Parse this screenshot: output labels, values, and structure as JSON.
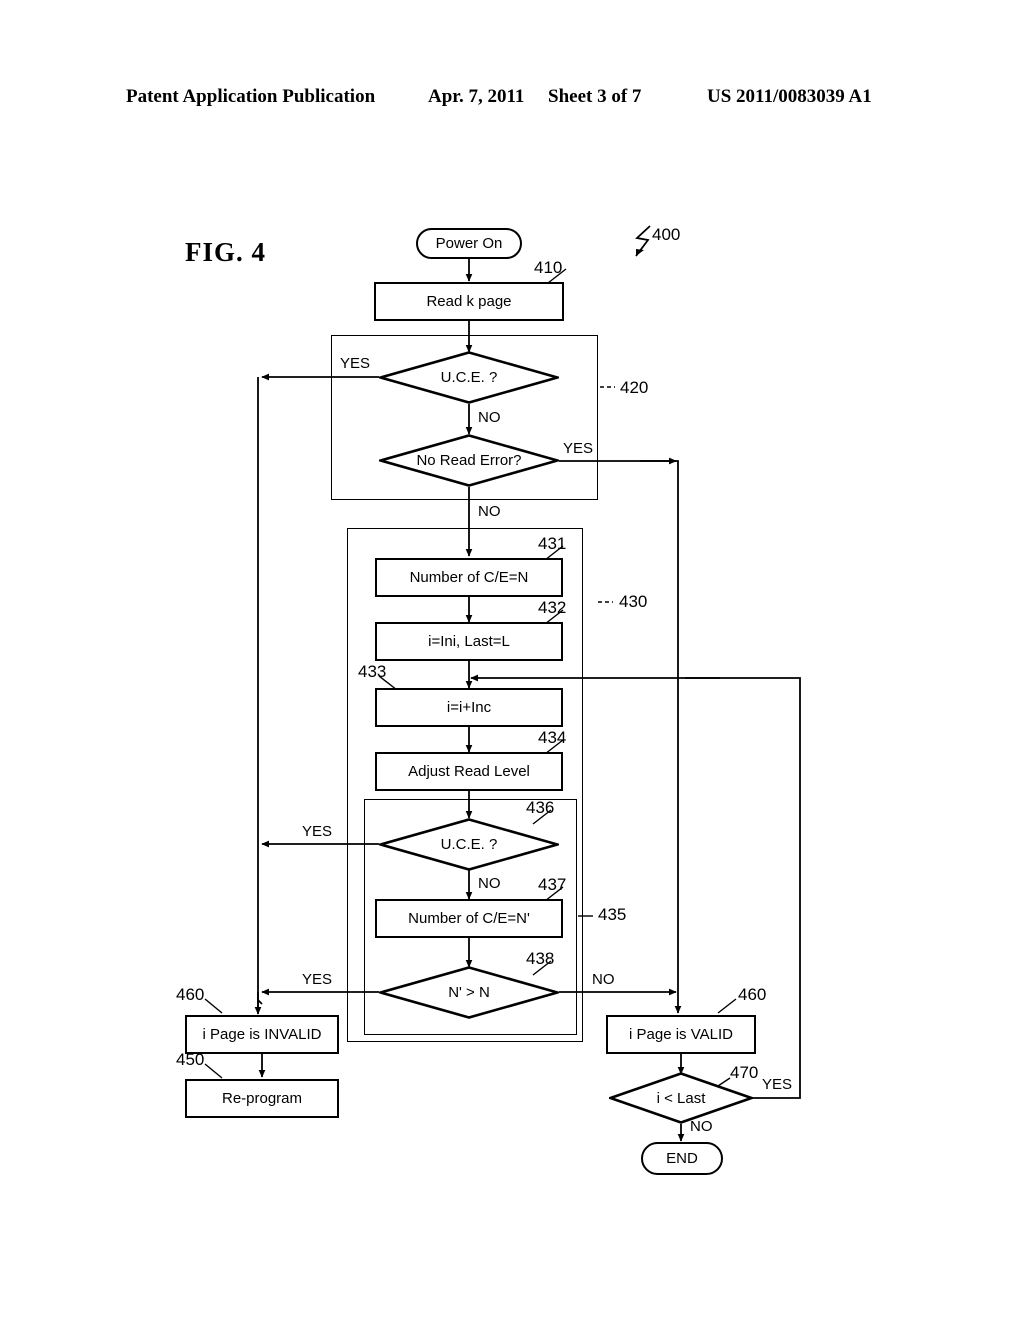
{
  "header": {
    "publication": "Patent Application Publication",
    "date": "Apr. 7, 2011",
    "sheet": "Sheet 3 of 7",
    "number": "US 2011/0083039 A1"
  },
  "figure": {
    "caption": "FIG.  4",
    "diagram_ref": "400"
  },
  "nodes": {
    "power_on": "Power On",
    "read_k_page": "Read k page",
    "uce_1": "U.C.E. ?",
    "no_read_error": "No Read Error?",
    "number_ce_n": "Number of C/E=N",
    "init": "i=Ini, Last=L",
    "increment": "i=i+Inc",
    "adjust_read_level": "Adjust Read Level",
    "uce_2": "U.C.E. ?",
    "number_ce_nprime": "Number of C/E=N'",
    "n_compare": "N' > N",
    "page_invalid": "i Page is INVALID",
    "reprogram": "Re-program",
    "page_valid": "i Page is VALID",
    "i_less_last": "i < Last",
    "end": "END"
  },
  "refs": {
    "r400": "400",
    "r410": "410",
    "r420": "420",
    "r430": "430",
    "r431": "431",
    "r432": "432",
    "r433": "433",
    "r434": "434",
    "r435": "435",
    "r436": "436",
    "r437": "437",
    "r438": "438",
    "r450": "450",
    "r460_left": "460",
    "r460_right": "460",
    "r470": "470"
  },
  "edges": {
    "uce1_yes": "YES",
    "uce1_no": "NO",
    "nre_yes": "YES",
    "nre_no": "NO",
    "uce2_yes": "YES",
    "uce2_no": "NO",
    "ncmp_yes": "YES",
    "ncmp_no": "NO",
    "last_yes": "YES",
    "last_no": "NO"
  },
  "style": {
    "ink": "#000000",
    "paper": "#ffffff"
  }
}
